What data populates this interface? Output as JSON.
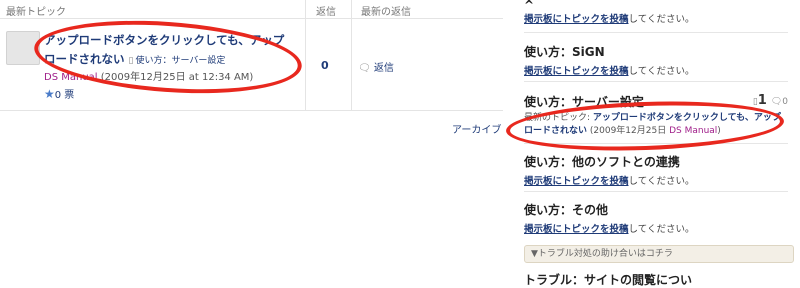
{
  "table": {
    "col_topic": "最新トピック",
    "col_replies": "返信",
    "col_latest": "最新の返信"
  },
  "topic": {
    "title": "アップロードボタンをクリックしても、アップロードされない",
    "forum_label": "使い方：サーバー設定",
    "author_prefix": "",
    "author": "DS Manual",
    "date": "(2009年12月25日 at 12:34 AM)",
    "votes": "0 票",
    "reply_count": "0",
    "reply_label": "返信"
  },
  "archive": "アーカイブ",
  "sidebar": {
    "post_link": "掲示板にトピックを投稿",
    "post_suffix": "してください。",
    "sections": [
      {
        "title": "使い方：SiGN"
      },
      {
        "title": "使い方：サーバー設定",
        "topics": "1",
        "posts": "0",
        "latest_label": "最新のトピック: ",
        "latest_title": "アップロードボタンをクリックしても、アップロードされない",
        "latest_date": "(2009年12月25日 ",
        "latest_user": "DS Manual",
        "latest_close": ")"
      },
      {
        "title": "使い方：他のソフトとの連携"
      },
      {
        "title": "使い方：その他"
      }
    ],
    "help_box": "▼トラブル対処の助け合いはコチラ",
    "cut_title": "トラブル：サイトの閲覧につい"
  }
}
